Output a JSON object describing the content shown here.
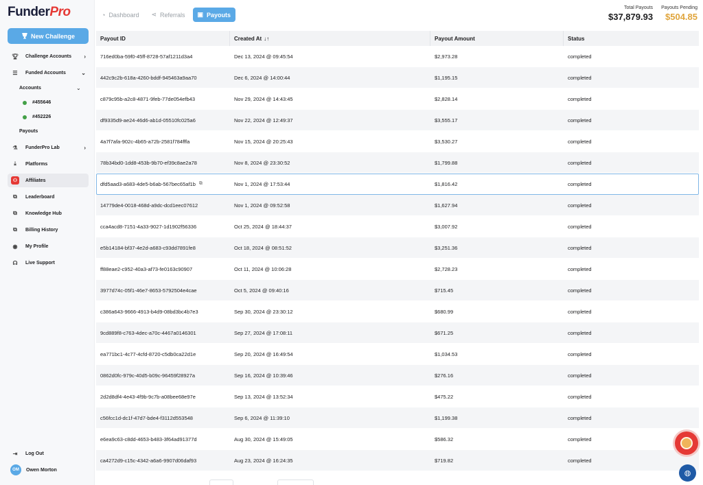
{
  "app": {
    "logo_main": "Funder",
    "logo_accent": "Pro"
  },
  "sidebar": {
    "new_challenge": "New Challenge",
    "items": [
      {
        "label": "Challenge Accounts",
        "icon": "trophy-icon",
        "chevron": "›"
      },
      {
        "label": "Funded Accounts",
        "icon": "list-icon",
        "chevron": "⌄"
      },
      {
        "label": "FunderPro Lab",
        "icon": "flask-icon",
        "chevron": "›"
      },
      {
        "label": "Platforms",
        "icon": "download-icon"
      },
      {
        "label": "Affiliates",
        "icon": "affiliate-icon"
      },
      {
        "label": "Leaderboard",
        "icon": "external-link-icon"
      },
      {
        "label": "Knowledge Hub",
        "icon": "external-link-icon"
      },
      {
        "label": "Billing History",
        "icon": "external-link-icon"
      },
      {
        "label": "My Profile",
        "icon": "user-circle-icon"
      },
      {
        "label": "Live Support",
        "icon": "headset-icon"
      }
    ],
    "accounts_label": "Accounts",
    "accounts": [
      "#455646",
      "#452226"
    ],
    "payouts_label": "Payouts",
    "logout": "Log Out",
    "user_initials": "OM",
    "user_name": "Owen Morton"
  },
  "tabs": [
    {
      "label": "Dashboard",
      "icon": "gauge-icon"
    },
    {
      "label": "Referrals",
      "icon": "share-icon"
    },
    {
      "label": "Payouts",
      "icon": "wallet-icon"
    }
  ],
  "totals": {
    "total_payouts_label": "Total Payouts",
    "total_payouts_value": "$37,879.93",
    "payouts_pending_label": "Payouts Pending",
    "payouts_pending_value": "$504.85"
  },
  "table": {
    "columns": [
      "Payout ID",
      "Created At",
      "Payout Amount",
      "Status"
    ],
    "sort_indicator": "↓↑",
    "rows": [
      [
        "716ed0ba-59f0-45ff-8728-57af1211d3a4",
        "Dec 13, 2024 @ 09:45:54",
        "$2,973.28",
        "completed"
      ],
      [
        "442c9c2b-618a-4260-bddf-945463a9aa70",
        "Dec 6, 2024 @ 14:00:44",
        "$1,195.15",
        "completed"
      ],
      [
        "c879c95b-a2c8-4871-9feb-77de054efb43",
        "Nov 29, 2024 @ 14:43:45",
        "$2,828.14",
        "completed"
      ],
      [
        "df9335d9-ae24-46d6-ab1d-05510fc025a6",
        "Nov 22, 2024 @ 12:49:37",
        "$3,555.17",
        "completed"
      ],
      [
        "4a7f7afa-902c-4b65-a72b-2581f784fffa",
        "Nov 15, 2024 @ 20:25:43",
        "$3,530.27",
        "completed"
      ],
      [
        "78b34bd0-1dd8-453b-9b70-ef39c8ae2a78",
        "Nov 8, 2024 @ 23:30:52",
        "$1,799.88",
        "completed"
      ],
      [
        "dfd5aad3-a683-4de5-b6ab-567bec65af1b",
        "Nov 1, 2024 @ 17:53:44",
        "$1,816.42",
        "completed"
      ],
      [
        "14779de4-0018-468d-a9dc-dcd1eec07612",
        "Nov 1, 2024 @ 09:52:58",
        "$1,627.94",
        "completed"
      ],
      [
        "cca4acd8-7151-4a33-9027-1d1902f56336",
        "Oct 25, 2024 @ 18:44:37",
        "$3,007.92",
        "completed"
      ],
      [
        "e5b14184-bf37-4e2d-a683-c93dd7891fe8",
        "Oct 18, 2024 @ 08:51:52",
        "$3,251.36",
        "completed"
      ],
      [
        "ff88eae2-c952-40a3-af73-fe0163c90907",
        "Oct 11, 2024 @ 10:06:28",
        "$2,728.23",
        "completed"
      ],
      [
        "3977d74c-05f1-46e7-8653-5792504e4cae",
        "Oct 5, 2024 @ 09:40:16",
        "$715.45",
        "completed"
      ],
      [
        "c386a643-9666-4913-b4d9-08bd3bc4b7e3",
        "Sep 30, 2024 @ 23:30:12",
        "$680.99",
        "completed"
      ],
      [
        "9cd889f8-c763-4dec-a70c-4467a0146301",
        "Sep 27, 2024 @ 17:08:11",
        "$671.25",
        "completed"
      ],
      [
        "ea771bc1-4c77-4cfd-8720-c5db0ca22d1e",
        "Sep 20, 2024 @ 16:49:54",
        "$1,034.53",
        "completed"
      ],
      [
        "0862d0fc-979c-40d5-b09c-96459f28927a",
        "Sep 16, 2024 @ 10:39:46",
        "$276.16",
        "completed"
      ],
      [
        "2d2d8df4-4e43-4f9b-9c7b-a08bee68e97e",
        "Sep 13, 2024 @ 13:52:34",
        "$475.22",
        "completed"
      ],
      [
        "c56fcc1d-dc1f-47d7-bde4-f3112d553548",
        "Sep 6, 2024 @ 11:39:10",
        "$1,199.38",
        "completed"
      ],
      [
        "e6ea9c63-c8dd-4653-b483-3f64ad91377d",
        "Aug 30, 2024 @ 15:49:05",
        "$586.32",
        "completed"
      ],
      [
        "ca4272d9-c15c-4342-a6a6-9907d06daf93",
        "Aug 23, 2024 @ 16:24:35",
        "$719.82",
        "completed"
      ]
    ],
    "selected_row": 6,
    "copy_icon": "copy-icon"
  },
  "colors": {
    "accent": "#5aa9e6",
    "brand_red": "#e53935",
    "pending": "#e0a53c",
    "status_dot": "#43a047"
  }
}
